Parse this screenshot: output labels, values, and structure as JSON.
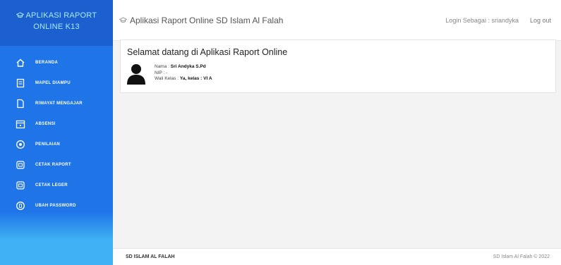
{
  "sidebar": {
    "brand_line1": "APLIKASI RAPORT",
    "brand_line2": "ONLINE K13",
    "brand_icon": "graduation-cap-icon",
    "items": [
      {
        "label": "BERANDA",
        "icon": "home-icon"
      },
      {
        "label": "MAPEL DIAMPU",
        "icon": "book-icon"
      },
      {
        "label": "RIWAYAT MENGAJAR",
        "icon": "file-icon"
      },
      {
        "label": "ABSENSI",
        "icon": "calendar-icon"
      },
      {
        "label": "PENILAIAN",
        "icon": "grade-icon"
      },
      {
        "label": "CETAK RAPORT",
        "icon": "print-icon"
      },
      {
        "label": "CETAK LEGER",
        "icon": "print-icon"
      },
      {
        "label": "UBAH PASSWORD",
        "icon": "key-icon"
      }
    ]
  },
  "header": {
    "title": "Aplikasi Raport Online SD Islam Al Falah",
    "login_text": "Login Sebagai : sriandyka",
    "logout_label": "Log out"
  },
  "welcome": {
    "heading": "Selamat datang di Aplikasi Raport Online",
    "nama_label": "Nama : ",
    "nama_value": "Sri Andyka S.Pd",
    "nip_label": "NIP : ",
    "nip_value": "-",
    "wali_label": "Wali Kelas : ",
    "wali_value": "Ya, kelas : VI A"
  },
  "footer": {
    "left": "SD ISLAM AL FALAH",
    "right": "SD Islam Al Falah © 2022"
  },
  "colors": {
    "sidebar": "#1f74e8",
    "sidebar_bottom": "#3fb0f3",
    "brand_bg": "#1c5fcf",
    "brand_text": "#a9ecff"
  }
}
